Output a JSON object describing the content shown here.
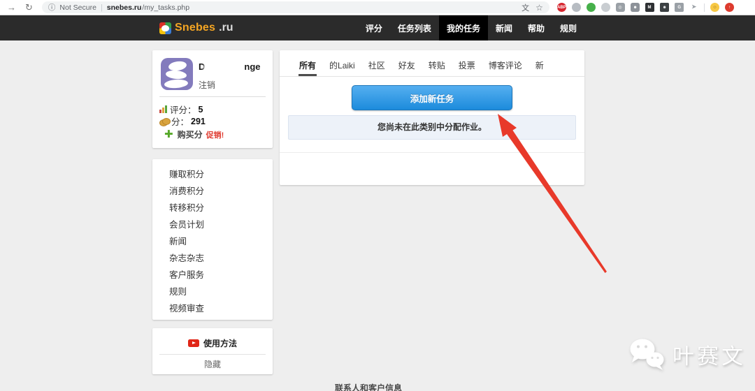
{
  "browser": {
    "forward_glyph": "→",
    "reload_glyph": "↻",
    "info_glyph": "ⓘ",
    "security_label": "Not Secure",
    "url_host": "snebes.ru",
    "url_path": "/my_tasks.php",
    "translate_glyph": "文",
    "star_glyph": "☆",
    "extensions": [
      {
        "name": "adblock-plus-icon",
        "glyph": "ABP",
        "bg": "#d6252e",
        "color": "#ffffff",
        "shape": "circle"
      },
      {
        "name": "hand-extension-icon",
        "glyph": "",
        "bg": "#b7bcc2",
        "color": "#ffffff",
        "shape": "circle"
      },
      {
        "name": "evernote-icon",
        "glyph": "",
        "bg": "#46b04a",
        "color": "#ffffff",
        "shape": "circle"
      },
      {
        "name": "contrast-circle-icon",
        "glyph": "",
        "bg": "#c9cdd1",
        "color": "#ffffff",
        "shape": "circle"
      },
      {
        "name": "camera-icon",
        "glyph": "◎",
        "bg": "#9aa0a6",
        "color": "#ffffff",
        "shape": "rounded"
      },
      {
        "name": "robot-icon",
        "glyph": "☻",
        "bg": "#8d9299",
        "color": "#ffffff",
        "shape": "rounded"
      },
      {
        "name": "medium-icon",
        "glyph": "M",
        "bg": "#2e3033",
        "color": "#ffffff",
        "shape": "square"
      },
      {
        "name": "person-badge-icon",
        "glyph": "☻",
        "bg": "#3c4043",
        "color": "#e8eaed",
        "shape": "square"
      },
      {
        "name": "google-g-icon",
        "glyph": "G",
        "bg": "#9aa0a6",
        "color": "#ffffff",
        "shape": "square"
      },
      {
        "name": "share-arrow-icon",
        "glyph": "➤",
        "bg": "transparent",
        "color": "#9aa0a6",
        "shape": "plain"
      },
      {
        "name": "toolbar-divider",
        "glyph": "",
        "bg": "#dadce0",
        "color": "",
        "shape": "divider"
      },
      {
        "name": "smiley-extension-icon",
        "glyph": "☺",
        "bg": "#f7c844",
        "color": "#8a6516",
        "shape": "circle"
      },
      {
        "name": "profile-avatar-icon",
        "glyph": "↑",
        "bg": "#dd3b2e",
        "color": "#ffffff",
        "shape": "circle"
      }
    ]
  },
  "navbar": {
    "logo_text": "Snebes",
    "logo_suffix": ".ru",
    "items": [
      {
        "name": "nav-item-rating",
        "label": "评分"
      },
      {
        "name": "nav-item-task-list",
        "label": "任务列表"
      },
      {
        "name": "nav-item-my-tasks",
        "label": "我的任务",
        "active": true
      },
      {
        "name": "nav-item-news",
        "label": "新闻"
      },
      {
        "name": "nav-item-help",
        "label": "帮助"
      },
      {
        "name": "nav-item-rules",
        "label": "规则"
      }
    ]
  },
  "sidebar": {
    "profile": {
      "username_prefix": "D",
      "username_suffix": "nge",
      "logout_label": "注销",
      "rating_label": "评分：",
      "rating_value": "5",
      "points_label": "分：",
      "points_value": "291",
      "buy_points_label": "购买分",
      "promo_label": "促销!"
    },
    "menu": [
      {
        "name": "sidebar-item-earn-points",
        "label": "赚取积分"
      },
      {
        "name": "sidebar-item-spend-points",
        "label": "消费积分"
      },
      {
        "name": "sidebar-item-transfer-points",
        "label": "转移积分"
      },
      {
        "name": "sidebar-item-membership-plan",
        "label": "会员计划"
      },
      {
        "name": "sidebar-item-news",
        "label": "新闻"
      },
      {
        "name": "sidebar-item-magazine",
        "label": "杂志杂志"
      },
      {
        "name": "sidebar-item-customer-service",
        "label": "客户服务"
      },
      {
        "name": "sidebar-item-rules",
        "label": "规则"
      },
      {
        "name": "sidebar-item-video-review",
        "label": "视频审查"
      }
    ],
    "help": {
      "video_label": "使用方法",
      "hide_label": "隐藏"
    }
  },
  "main": {
    "tabs": [
      {
        "name": "tab-all",
        "label": "所有",
        "active": true
      },
      {
        "name": "tab-laiki",
        "label": "的Laiki"
      },
      {
        "name": "tab-community",
        "label": "社区"
      },
      {
        "name": "tab-friends",
        "label": "好友"
      },
      {
        "name": "tab-repost",
        "label": "转贴"
      },
      {
        "name": "tab-vote",
        "label": "投票"
      },
      {
        "name": "tab-blog-comments",
        "label": "博客评论"
      },
      {
        "name": "tab-new",
        "label": "新"
      }
    ],
    "add_task_button_label": "添加新任务",
    "empty_message": "您尚未在此类别中分配作业。"
  },
  "footer": {
    "contact_heading": "联系人和客户信息"
  },
  "watermark": {
    "text": "叶赛文"
  },
  "colors": {
    "accent_blue": "#2e96e6",
    "navbar_bg": "#2b2b2b",
    "arrow_red": "#e8392a",
    "logo_orange": "#f5a623",
    "promo_red": "#e03c31",
    "page_bg": "#eeeeee"
  }
}
